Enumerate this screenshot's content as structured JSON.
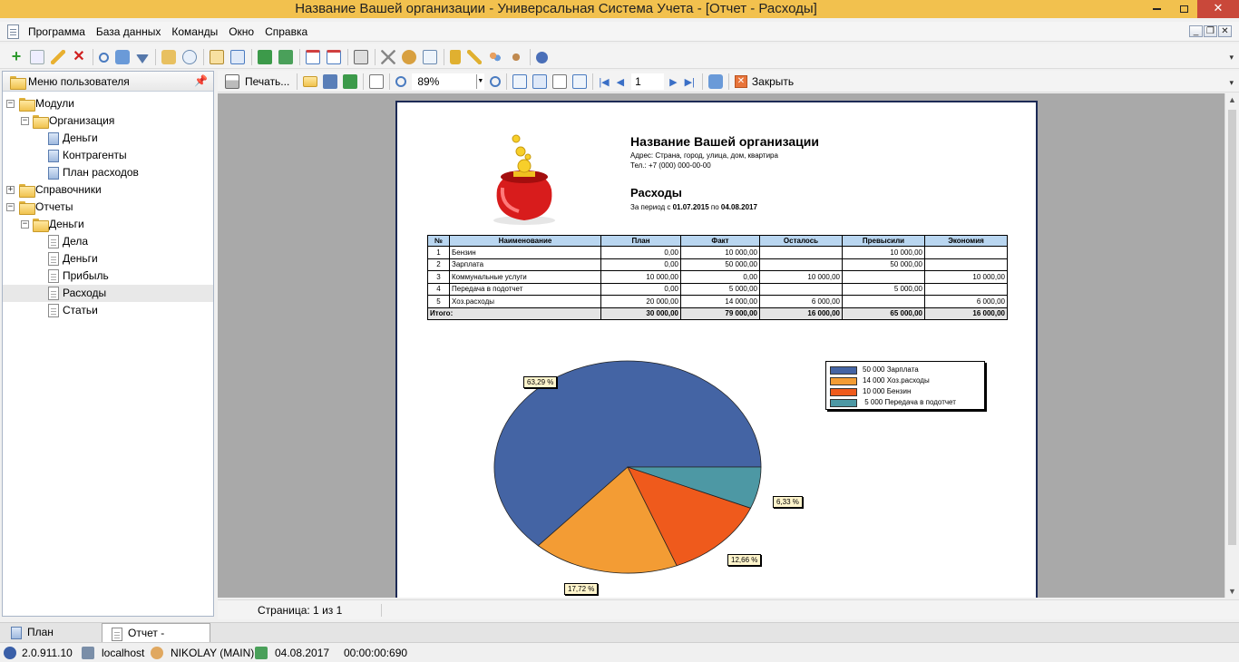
{
  "window": {
    "title": "Название Вашей организации - Универсальная Система Учета - [Отчет - Расходы]"
  },
  "menu": {
    "items": [
      "Программа",
      "База данных",
      "Команды",
      "Окно",
      "Справка"
    ]
  },
  "left_panel": {
    "title": "Меню пользователя",
    "tree": [
      {
        "label": "Модули",
        "level": 0,
        "icon": "folder-icon",
        "expanded": true
      },
      {
        "label": "Организация",
        "level": 1,
        "icon": "folder-icon",
        "expanded": true
      },
      {
        "label": "Деньги",
        "level": 2,
        "icon": "document-icon"
      },
      {
        "label": "Контрагенты",
        "level": 2,
        "icon": "document-icon"
      },
      {
        "label": "План расходов",
        "level": 2,
        "icon": "document-icon"
      },
      {
        "label": "Справочники",
        "level": 0,
        "icon": "folder-icon",
        "expanded": false
      },
      {
        "label": "Отчеты",
        "level": 0,
        "icon": "folder-icon",
        "expanded": true
      },
      {
        "label": "Деньги",
        "level": 1,
        "icon": "folder-icon",
        "expanded": true
      },
      {
        "label": "Дела",
        "level": 2,
        "icon": "report-icon"
      },
      {
        "label": "Деньги",
        "level": 2,
        "icon": "report-icon"
      },
      {
        "label": "Прибыль",
        "level": 2,
        "icon": "report-icon"
      },
      {
        "label": "Расходы",
        "level": 2,
        "icon": "report-icon",
        "selected": true
      },
      {
        "label": "Статьи",
        "level": 2,
        "icon": "report-icon"
      }
    ]
  },
  "report_toolbar": {
    "print_label": "Печать...",
    "zoom_value": "89%",
    "page_value": "1",
    "close_label": "Закрыть"
  },
  "report": {
    "org_name": "Название Вашей организации",
    "address": "Адрес: Страна, город, улица, дом, квартира",
    "phone": "Тел.: +7 (000) 000-00-00",
    "title": "Расходы",
    "period_prefix": "За период с",
    "period_from": "01.07.2015",
    "period_mid": "по",
    "period_to": "04.08.2017",
    "table": {
      "headers": [
        "№",
        "Наименование",
        "План",
        "Факт",
        "Осталось",
        "Превысили",
        "Экономия"
      ],
      "rows": [
        [
          "1",
          "Бензин",
          "0,00",
          "10 000,00",
          "",
          "10 000,00",
          ""
        ],
        [
          "2",
          "Зарплата",
          "0,00",
          "50 000,00",
          "",
          "50 000,00",
          ""
        ],
        [
          "3",
          "Коммунальные услуги",
          "10 000,00",
          "0,00",
          "10 000,00",
          "",
          "10 000,00"
        ],
        [
          "4",
          "Передача в подотчет",
          "0,00",
          "5 000,00",
          "",
          "5 000,00",
          ""
        ],
        [
          "5",
          "Хоз.расходы",
          "20 000,00",
          "14 000,00",
          "6 000,00",
          "",
          "6 000,00"
        ]
      ],
      "total_label": "Итого:",
      "totals": [
        "30 000,00",
        "79 000,00",
        "16 000,00",
        "65 000,00",
        "16 000,00"
      ]
    }
  },
  "chart_data": {
    "type": "pie",
    "categories": [
      "Зарплата",
      "Хоз.расходы",
      "Бензин",
      "Передача в подотчет"
    ],
    "values": [
      50000,
      14000,
      10000,
      5000
    ],
    "legend_labels": [
      "50 000 Зарплата",
      "14 000 Хоз.расходы",
      "10 000 Бензин",
      " 5 000 Передача в подотчет"
    ],
    "percent_labels": [
      "63,29 %",
      "17,72 %",
      "12,66 %",
      "6,33 %"
    ],
    "colors": [
      "#4464a4",
      "#f39c34",
      "#ef5a1c",
      "#4d98a4"
    ],
    "legend_position": "top-right"
  },
  "page_bar": {
    "text": "Страница: 1 из 1"
  },
  "tabs": [
    "План расходов",
    "Отчет - Расходы"
  ],
  "status": {
    "version": "2.0.911.10",
    "host": "localhost",
    "user": "NIKOLAY (MAIN)",
    "date": "04.08.2017",
    "time": "00:00:00:690"
  }
}
